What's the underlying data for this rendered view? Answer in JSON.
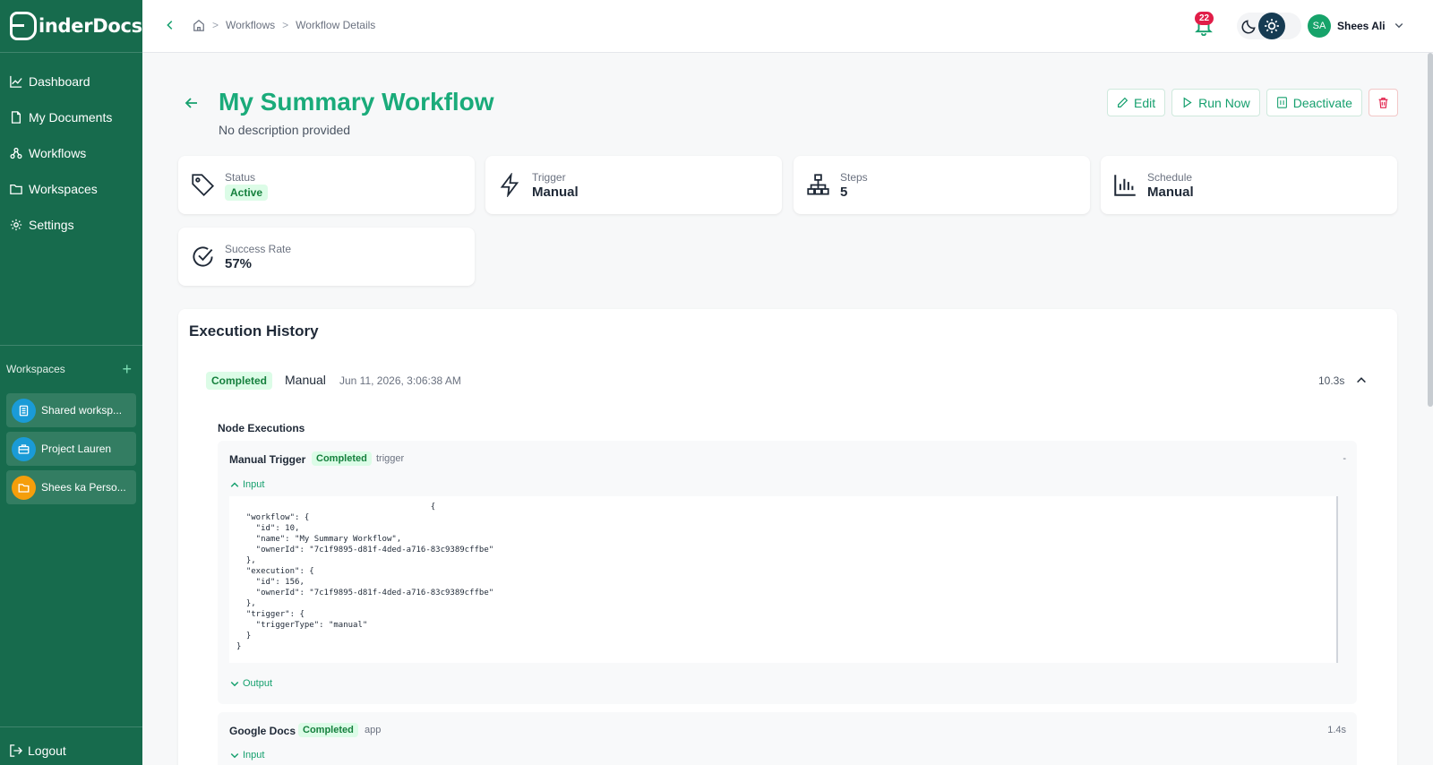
{
  "app": {
    "logo_text": "inderDocs"
  },
  "sidebar": {
    "nav": [
      {
        "label": "Dashboard",
        "icon": "chart-line-icon"
      },
      {
        "label": "My Documents",
        "icon": "document-icon"
      },
      {
        "label": "Workflows",
        "icon": "workflow-icon"
      },
      {
        "label": "Workspaces",
        "icon": "folder-icon"
      },
      {
        "label": "Settings",
        "icon": "gear-icon"
      }
    ],
    "workspaces_heading": "Workspaces",
    "workspaces": [
      {
        "label": "Shared worksp...",
        "color": "#1a9bd7",
        "icon": "document-icon"
      },
      {
        "label": "Project Lauren",
        "color": "#1a9bd7",
        "icon": "briefcase-icon"
      },
      {
        "label": "Shees ka Perso...",
        "color": "#f59e0b",
        "icon": "folder-icon"
      }
    ],
    "logout_label": "Logout"
  },
  "topbar": {
    "breadcrumb": [
      "Workflows",
      "Workflow Details"
    ],
    "notification_count": "22",
    "user_initials": "SA",
    "user_name": "Shees Ali"
  },
  "workflow": {
    "title": "My Summary Workflow",
    "description": "No description provided",
    "actions": {
      "edit": "Edit",
      "run": "Run Now",
      "deactivate": "Deactivate"
    }
  },
  "stats": {
    "status": {
      "label": "Status",
      "value": "Active"
    },
    "trigger": {
      "label": "Trigger",
      "value": "Manual"
    },
    "steps": {
      "label": "Steps",
      "value": "5"
    },
    "schedule": {
      "label": "Schedule",
      "value": "Manual"
    },
    "success": {
      "label": "Success Rate",
      "value": "57%"
    }
  },
  "history": {
    "title": "Execution History",
    "execution": {
      "status": "Completed",
      "trigger": "Manual",
      "date": "Jun 11, 2026, 3:06:38 AM",
      "duration": "10.3s"
    },
    "node_heading": "Node Executions",
    "nodes": [
      {
        "name": "Manual Trigger",
        "status": "Completed",
        "type": "trigger",
        "time": "-",
        "input_label": "Input",
        "output_label": "Output",
        "input_json": "                                        {\n  \"workflow\": {\n    \"id\": 10,\n    \"name\": \"My Summary Workflow\",\n    \"ownerId\": \"7c1f9895-d81f-4ded-a716-83c9389cffbe\"\n  },\n  \"execution\": {\n    \"id\": 156,\n    \"ownerId\": \"7c1f9895-d81f-4ded-a716-83c9389cffbe\"\n  },\n  \"trigger\": {\n    \"triggerType\": \"manual\"\n  }\n}"
      },
      {
        "name": "Google Docs",
        "status": "Completed",
        "type": "app",
        "time": "1.4s",
        "input_label": "Input"
      }
    ]
  }
}
